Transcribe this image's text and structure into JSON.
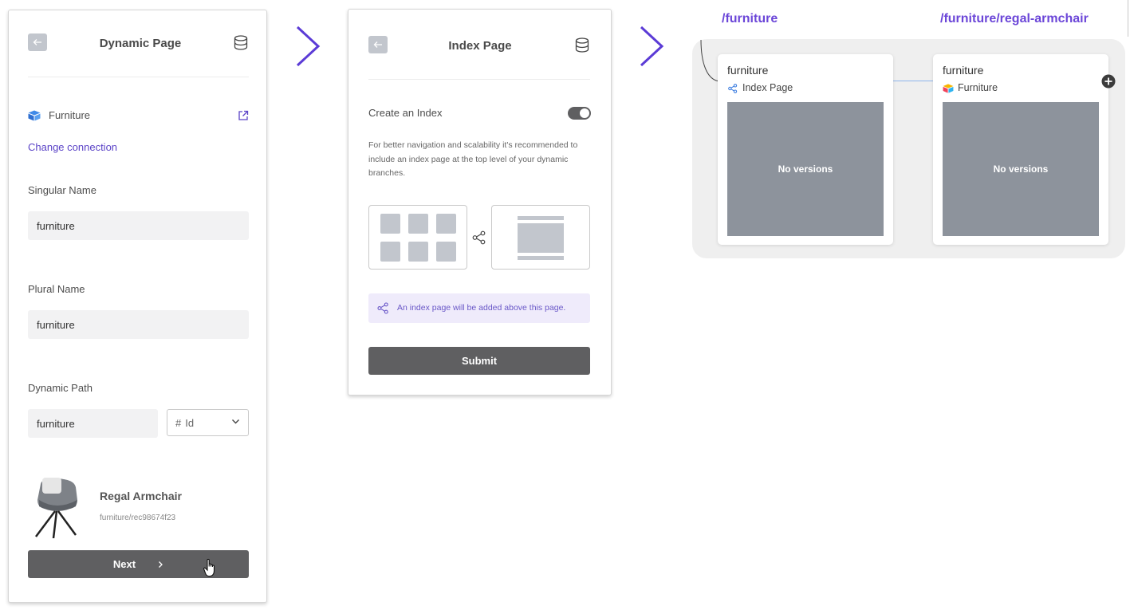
{
  "panel_dynamic": {
    "title": "Dynamic Page",
    "source_name": "Furniture",
    "change_connection": "Change connection",
    "singular_label": "Singular Name",
    "singular_value": "furniture",
    "plural_label": "Plural Name",
    "plural_value": "furniture",
    "path_label": "Dynamic Path",
    "path_value": "furniture",
    "path_select": {
      "prefix": "#",
      "value": "Id"
    },
    "record_title": "Regal Armchair",
    "record_path": "furniture/rec98674f23",
    "next_button": "Next"
  },
  "panel_index": {
    "title": "Index Page",
    "toggle_label": "Create an Index",
    "toggle_on": true,
    "description": "For better navigation and scalability it's recommended to include an index page at the top level of your dynamic branches.",
    "notice": "An index page will be added above this page.",
    "submit_button": "Submit"
  },
  "canvas": {
    "routes": [
      "/furniture",
      "/furniture/regal-armchair"
    ],
    "cards": [
      {
        "title": "furniture",
        "type": "Index Page",
        "preview": "No versions"
      },
      {
        "title": "furniture",
        "type": "Furniture",
        "preview": "No versions"
      }
    ]
  },
  "colors": {
    "accent": "#6b46d8",
    "dark_button": "#5f5f61",
    "preview": "#8d939c"
  }
}
